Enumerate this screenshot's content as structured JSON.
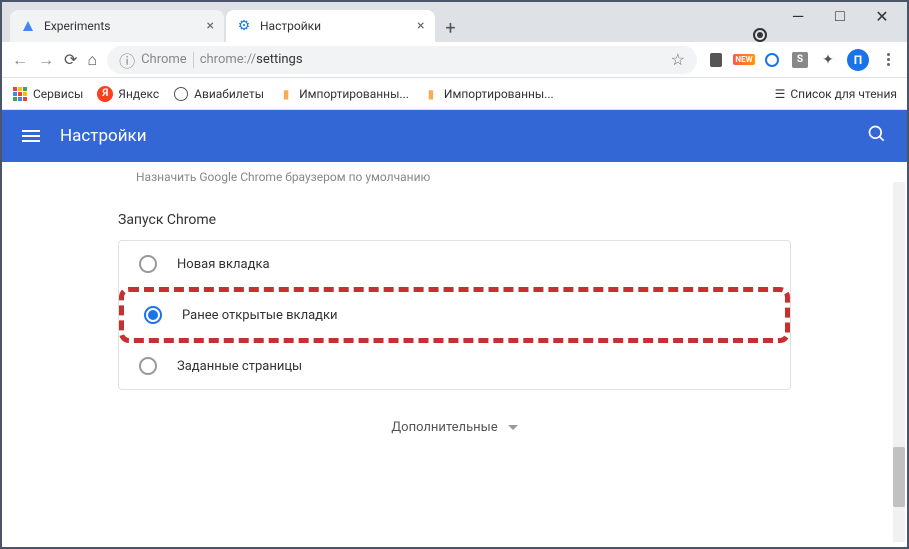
{
  "window": {
    "minimize": "—",
    "maximize": "□",
    "close": "✕"
  },
  "tabs": [
    {
      "title": "Experiments",
      "active": false
    },
    {
      "title": "Настройки",
      "active": true
    }
  ],
  "addressBar": {
    "prefix": "Chrome",
    "url": "chrome://settings"
  },
  "bookmarks": {
    "apps": "Сервисы",
    "yandex": "Яндекс",
    "aviabilets": "Авиабилеты",
    "imported1": "Импортированны...",
    "imported2": "Импортированны...",
    "readingList": "Список для чтения"
  },
  "profileLetter": "П",
  "settingsHeader": {
    "title": "Настройки"
  },
  "content": {
    "defaultBrowserText": "Назначить Google Chrome браузером по умолчанию",
    "startupSection": "Запуск Chrome",
    "options": [
      {
        "label": "Новая вкладка",
        "selected": false
      },
      {
        "label": "Ранее открытые вкладки",
        "selected": true
      },
      {
        "label": "Заданные страницы",
        "selected": false
      }
    ],
    "advanced": "Дополнительные"
  }
}
